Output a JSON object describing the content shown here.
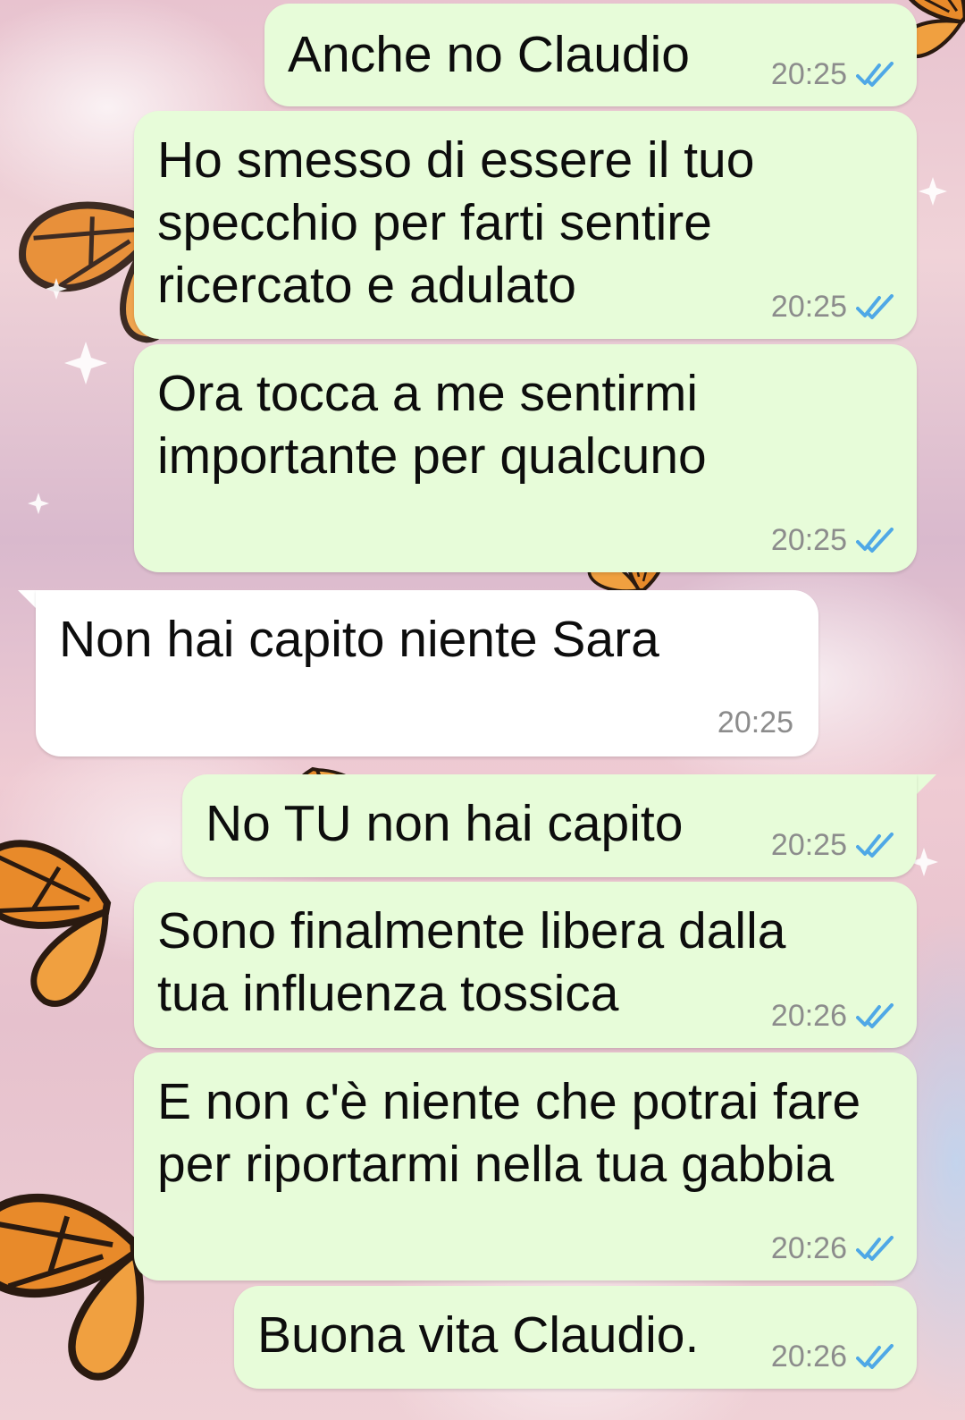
{
  "colors": {
    "outgoing_bubble": "#e7fcd9",
    "incoming_bubble": "#ffffff",
    "read_ticks": "#4fa8e6",
    "timestamp": "#8c8c8c"
  },
  "messages": [
    {
      "text": "Anche no Claudio",
      "time": "20:25",
      "direction": "outgoing",
      "status_icon": "double-check-read-icon"
    },
    {
      "text": "Ho smesso di essere il tuo\nspecchio per farti sentire\nricercato e adulato",
      "time": "20:25",
      "direction": "outgoing",
      "status_icon": "double-check-read-icon"
    },
    {
      "text": "Ora tocca a me sentirmi\nimportante per qualcuno",
      "time": "20:25",
      "direction": "outgoing",
      "status_icon": "double-check-read-icon"
    },
    {
      "text": "Non hai capito niente Sara",
      "time": "20:25",
      "direction": "incoming"
    },
    {
      "text": "No TU non hai capito",
      "time": "20:25",
      "direction": "outgoing",
      "status_icon": "double-check-read-icon"
    },
    {
      "text": "Sono finalmente libera dalla\ntua influenza tossica",
      "time": "20:26",
      "direction": "outgoing",
      "status_icon": "double-check-read-icon"
    },
    {
      "text": "E non c'è niente che potrai fare\nper riportarmi nella tua gabbia",
      "time": "20:26",
      "direction": "outgoing",
      "status_icon": "double-check-read-icon"
    },
    {
      "text": "Buona vita Claudio.",
      "time": "20:26",
      "direction": "outgoing",
      "status_icon": "double-check-read-icon"
    }
  ]
}
